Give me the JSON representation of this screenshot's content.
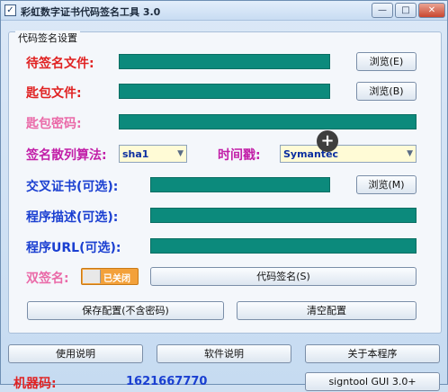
{
  "window": {
    "title": "彩虹数字证书代码签名工具 3.0",
    "controls": {
      "minimize": "—",
      "maximize": "□",
      "close": "✕"
    }
  },
  "group": {
    "title": "代码签名设置"
  },
  "rows": {
    "pending_file": {
      "label": "待签名文件:",
      "browse": "浏览(E)"
    },
    "key_file": {
      "label": "匙包文件:",
      "browse": "浏览(B)"
    },
    "key_password": {
      "label": "匙包密码:"
    },
    "hash": {
      "label": "签名散列算法:",
      "value": "sha1"
    },
    "timestamp": {
      "label": "时间戳:",
      "value": "Symantec"
    },
    "cross_cert": {
      "label": "交叉证书(可选):",
      "browse": "浏览(M)"
    },
    "description": {
      "label": "程序描述(可选):"
    },
    "url": {
      "label": "程序URL(可选):"
    },
    "dual_sign": {
      "label": "双签名:",
      "toggle": "已关闭",
      "sign_button": "代码签名(S)"
    }
  },
  "actions": {
    "save_config": "保存配置(不含密码)",
    "clear_config": "清空配置",
    "usage": "使用说明",
    "software_info": "软件说明",
    "about": "关于本程序",
    "signtool": "signtool GUI 3.0+"
  },
  "footer": {
    "machine_label": "机器码:",
    "machine_value": "1621667770"
  },
  "cursor": {
    "glyph": "+"
  },
  "colors": {
    "field": "#0c8a7c",
    "red": "#e02222",
    "magenta": "#c21fa8",
    "pink": "#ea6aa8",
    "blue": "#1a3fd1",
    "toggle": "#f3a13a"
  }
}
